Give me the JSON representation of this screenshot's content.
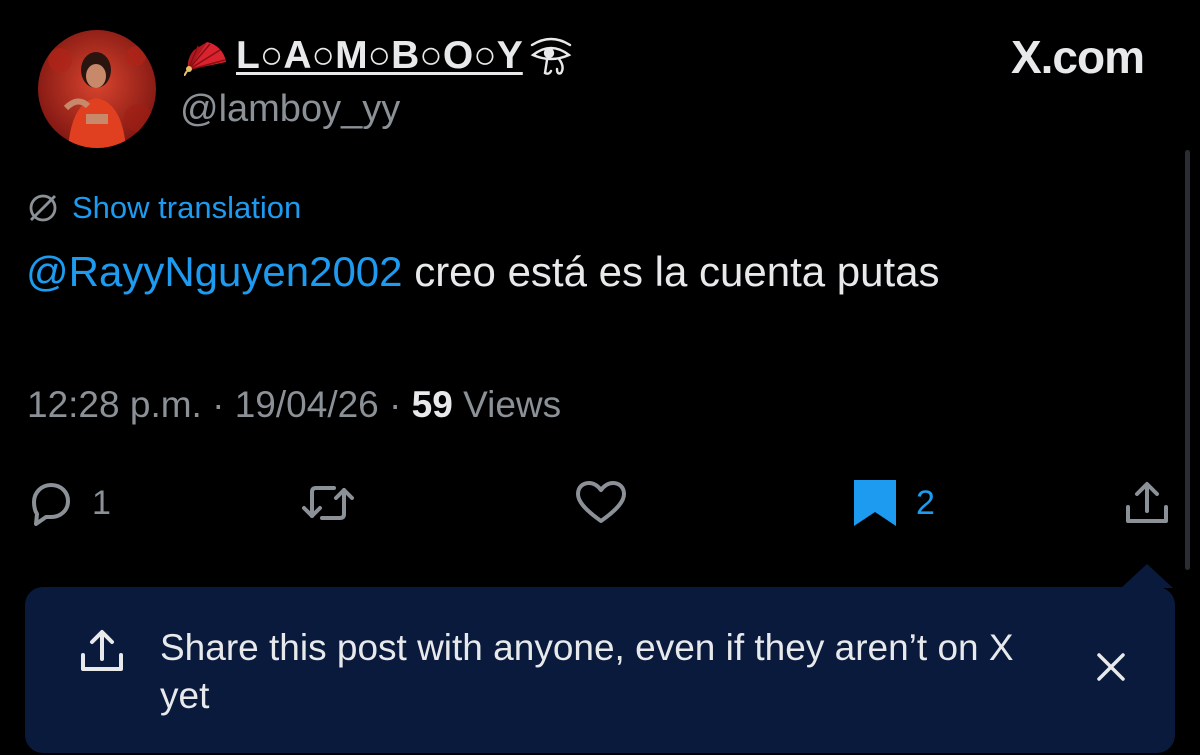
{
  "profile": {
    "display_name": "L○A○M○B○O○Y",
    "handle": "@lamboy_yy",
    "avatar_icon": "profile-photo"
  },
  "site": {
    "logo_text": "X.com"
  },
  "translation": {
    "label": "Show translation",
    "icon": "globe-off-icon"
  },
  "post": {
    "mention": "@RayyNguyen2002",
    "text": " creo está es la cuenta putas"
  },
  "meta": {
    "time": "12:28 p.m.",
    "separator1": " · ",
    "date": "19/04/26",
    "separator2": " · ",
    "views_count": "59",
    "views_label": " Views"
  },
  "actions": {
    "reply": {
      "icon": "reply-icon",
      "count": "1"
    },
    "repost": {
      "icon": "repost-icon",
      "count": ""
    },
    "like": {
      "icon": "heart-icon",
      "count": ""
    },
    "bookmark": {
      "icon": "bookmark-filled-icon",
      "count": "2",
      "active": true
    },
    "share": {
      "icon": "share-icon"
    }
  },
  "tooltip": {
    "text": "Share this post with anyone, even if they aren’t on X yet",
    "close_icon": "close-icon"
  },
  "colors": {
    "background": "#000000",
    "text": "#e7e9ea",
    "muted": "#8b9197",
    "accent": "#1d9bf0",
    "tooltip_bg": "#0a1a3d"
  }
}
